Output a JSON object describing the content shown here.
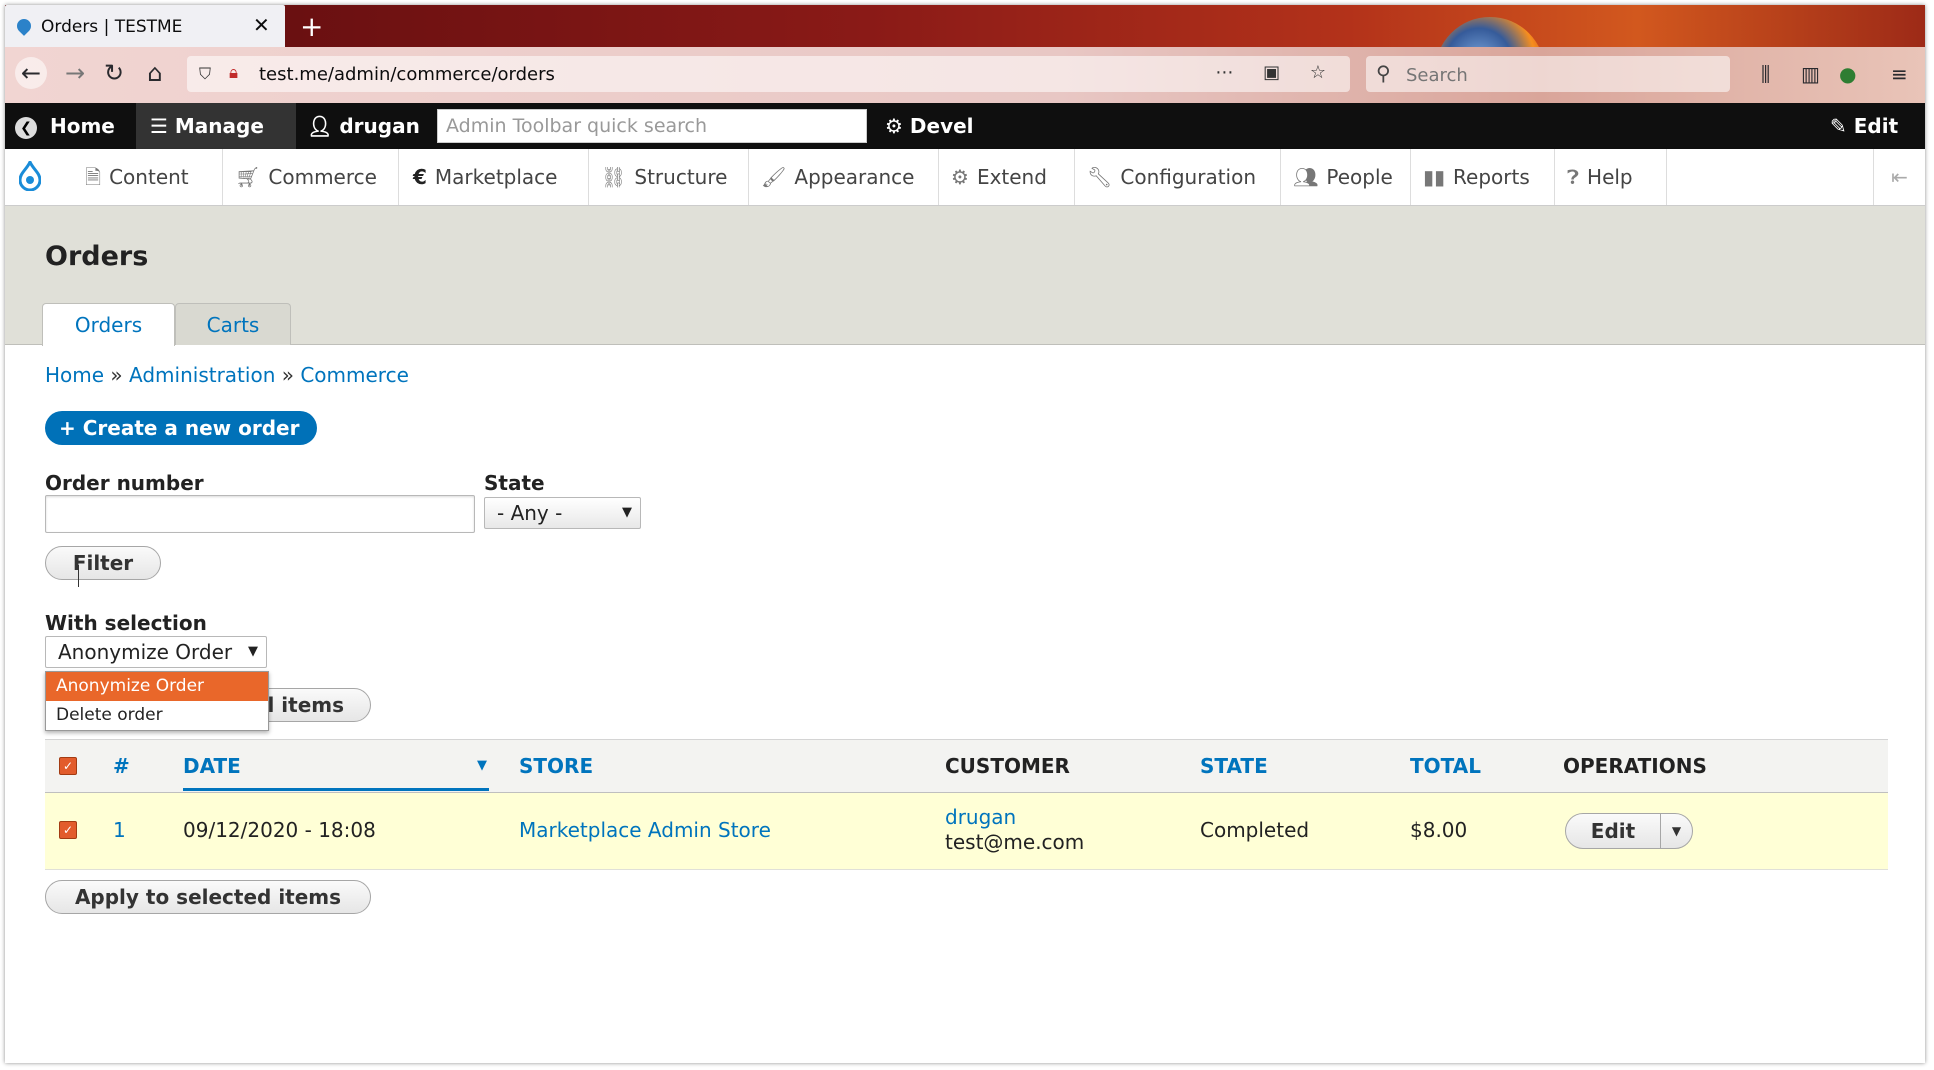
{
  "browser": {
    "tab_title": "Orders | TESTME",
    "new_tab": "+",
    "url": "test.me/admin/commerce/orders",
    "search_placeholder": "Search"
  },
  "toolbar": {
    "home": "Home",
    "manage": "Manage",
    "user": "drugan",
    "search_placeholder": "Admin Toolbar quick search",
    "devel": "Devel",
    "edit": "Edit"
  },
  "tray": [
    {
      "label": "Content",
      "icon": "content-icon"
    },
    {
      "label": "Commerce",
      "icon": "cart-icon"
    },
    {
      "label": "Marketplace",
      "icon": "euro-icon"
    },
    {
      "label": "Structure",
      "icon": "structure-icon"
    },
    {
      "label": "Appearance",
      "icon": "brush-icon"
    },
    {
      "label": "Extend",
      "icon": "puzzle-icon"
    },
    {
      "label": "Configuration",
      "icon": "wrench-icon"
    },
    {
      "label": "People",
      "icon": "people-icon"
    },
    {
      "label": "Reports",
      "icon": "reports-icon"
    },
    {
      "label": "Help",
      "icon": "help-icon"
    }
  ],
  "page": {
    "title": "Orders",
    "tabs": [
      "Orders",
      "Carts"
    ],
    "breadcrumb": [
      "Home",
      "Administration",
      "Commerce"
    ],
    "create_button": "+ Create a new order"
  },
  "filters": {
    "order_number_label": "Order number",
    "order_number_value": "",
    "state_label": "State",
    "state_value": "- Any -",
    "filter_button": "Filter"
  },
  "bulk": {
    "label": "With selection",
    "selected": "Anonymize Order",
    "options": [
      "Anonymize Order",
      "Delete order"
    ],
    "apply_partial": "l items",
    "apply_button": "Apply to selected items"
  },
  "table": {
    "headers": [
      "#",
      "DATE",
      "STORE",
      "CUSTOMER",
      "STATE",
      "TOTAL",
      "OPERATIONS"
    ],
    "rows": [
      {
        "id": "1",
        "date": "09/12/2020 - 18:08",
        "store": "Marketplace Admin Store",
        "customer_name": "drugan",
        "customer_email": "test@me.com",
        "state": "Completed",
        "total": "$8.00",
        "operation": "Edit"
      }
    ]
  },
  "colors": {
    "link": "#0074bd",
    "primary_button": "#0071b8",
    "row_highlight": "#ffffd6",
    "dropdown_selected": "#e9672a"
  }
}
